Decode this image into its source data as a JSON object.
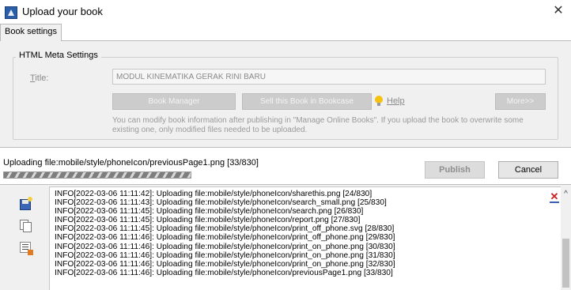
{
  "window": {
    "title": "Upload your book",
    "close_glyph": "✕"
  },
  "tabs": [
    {
      "label": "Book settings",
      "active": true
    }
  ],
  "meta_settings": {
    "group_title": "HTML Meta Settings",
    "title_label_accesskey": "T",
    "title_label_rest": "itle:",
    "title_value": "MODUL KINEMATIKA GERAK RINI BARU",
    "book_manager_label": "Book Manager",
    "sell_label": "Sell this Book in Bookcase",
    "help_label": "Help",
    "more_label": "More>>",
    "info_text": "You can modify book information after publishing in \"Manage Online Books\". If you upload the book to overwrite some existing one, only modified files needed to be uploaded."
  },
  "upload": {
    "status_text": "Uploading file:mobile/style/phoneIcon/previousPage1.png [33/830]",
    "progress_percent": 100,
    "publish_label": "Publish",
    "cancel_label": "Cancel"
  },
  "log": {
    "lines": [
      "INFO[2022-03-06 11:11:42]: Uploading file:mobile/style/phoneIcon/sharethis.png [24/830]",
      "INFO[2022-03-06 11:11:43]: Uploading file:mobile/style/phoneIcon/search_small.png [25/830]",
      "INFO[2022-03-06 11:11:45]: Uploading file:mobile/style/phoneIcon/search.png [26/830]",
      "INFO[2022-03-06 11:11:45]: Uploading file:mobile/style/phoneIcon/report.png [27/830]",
      "INFO[2022-03-06 11:11:45]: Uploading file:mobile/style/phoneIcon/print_off_phone.svg [28/830]",
      "INFO[2022-03-06 11:11:46]: Uploading file:mobile/style/phoneIcon/print_off_phone.png [29/830]",
      "INFO[2022-03-06 11:11:46]: Uploading file:mobile/style/phoneIcon/print_on_phone.png [30/830]",
      "INFO[2022-03-06 11:11:46]: Uploading file:mobile/style/phoneIcon/print_on_phone.png [31/830]",
      "INFO[2022-03-06 11:11:46]: Uploading file:mobile/style/phoneIcon/print_on_phone.png [32/830]",
      "INFO[2022-03-06 11:11:46]: Uploading file:mobile/style/phoneIcon/previousPage1.png [33/830]"
    ],
    "clear_glyph": "✕",
    "scroll_up_glyph": "^"
  },
  "icons": {
    "app": "app-icon",
    "help": "lightbulb-icon",
    "save": "save-icon",
    "copy": "copy-icon",
    "log_list": "log-list-icon",
    "clear": "clear-log-icon"
  }
}
